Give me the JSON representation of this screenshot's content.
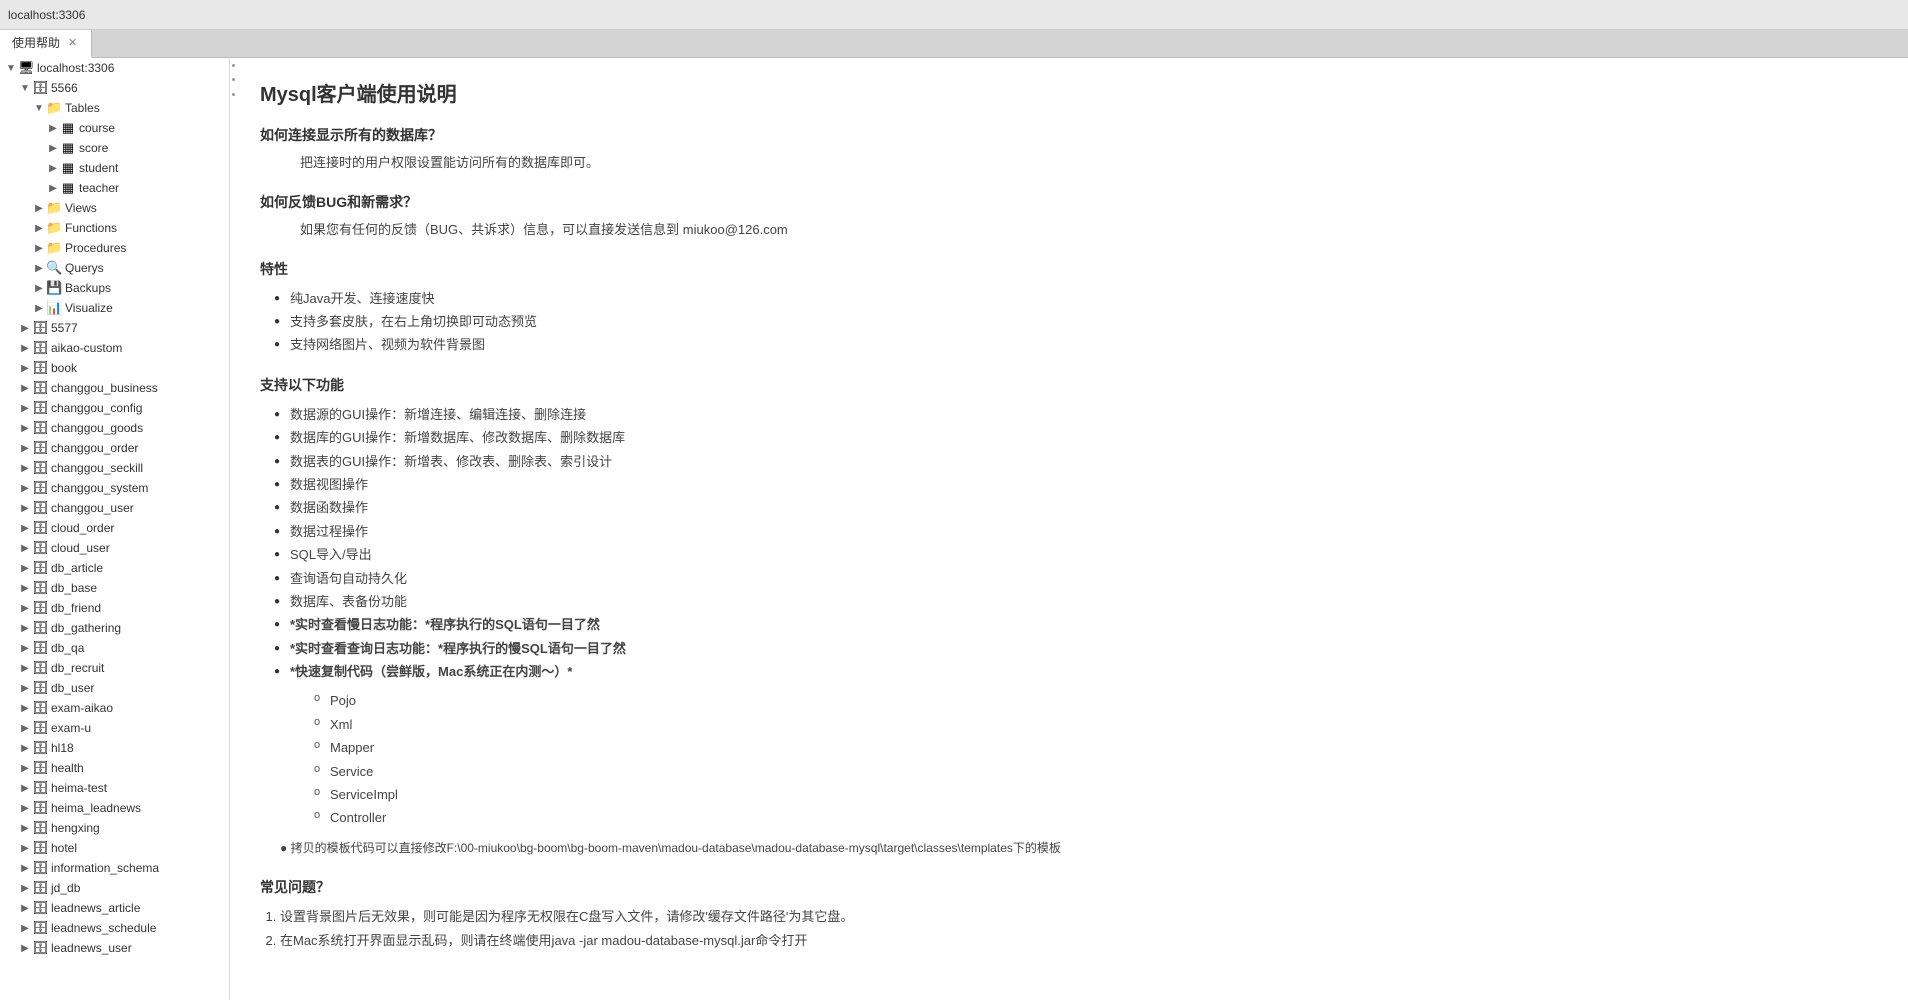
{
  "topbar": {
    "address": "localhost:3306"
  },
  "tabs": [
    {
      "label": "使用帮助",
      "active": true,
      "closable": true
    }
  ],
  "sidebar": {
    "databases": [
      {
        "name": "5566",
        "expanded": true,
        "children": [
          {
            "type": "folder",
            "name": "Tables",
            "expanded": true,
            "children": [
              {
                "name": "course"
              },
              {
                "name": "score"
              },
              {
                "name": "student"
              },
              {
                "name": "teacher"
              }
            ]
          },
          {
            "type": "folder",
            "name": "Views",
            "expanded": false
          },
          {
            "type": "folder",
            "name": "Functions",
            "expanded": false
          },
          {
            "type": "folder",
            "name": "Procedures",
            "expanded": false
          },
          {
            "type": "folder",
            "name": "Querys",
            "expanded": false
          },
          {
            "type": "folder",
            "name": "Backups",
            "expanded": false
          },
          {
            "type": "folder",
            "name": "Visualize",
            "expanded": false
          }
        ]
      },
      {
        "name": "5577",
        "expanded": false
      },
      {
        "name": "aikao-custom",
        "expanded": false
      },
      {
        "name": "book",
        "expanded": false
      },
      {
        "name": "changgou_business",
        "expanded": false
      },
      {
        "name": "changgou_config",
        "expanded": false
      },
      {
        "name": "changgou_goods",
        "expanded": false
      },
      {
        "name": "changgou_order",
        "expanded": false
      },
      {
        "name": "changgou_seckill",
        "expanded": false
      },
      {
        "name": "changgou_system",
        "expanded": false
      },
      {
        "name": "changgou_user",
        "expanded": false
      },
      {
        "name": "cloud_order",
        "expanded": false
      },
      {
        "name": "cloud_user",
        "expanded": false
      },
      {
        "name": "db_article",
        "expanded": false
      },
      {
        "name": "db_base",
        "expanded": false
      },
      {
        "name": "db_friend",
        "expanded": false
      },
      {
        "name": "db_gathering",
        "expanded": false
      },
      {
        "name": "db_qa",
        "expanded": false
      },
      {
        "name": "db_recruit",
        "expanded": false
      },
      {
        "name": "db_user",
        "expanded": false
      },
      {
        "name": "exam-aikao",
        "expanded": false
      },
      {
        "name": "exam-u",
        "expanded": false
      },
      {
        "name": "hl18",
        "expanded": false
      },
      {
        "name": "health",
        "expanded": false
      },
      {
        "name": "heima-test",
        "expanded": false
      },
      {
        "name": "heima_leadnews",
        "expanded": false
      },
      {
        "name": "hengxing",
        "expanded": false
      },
      {
        "name": "hotel",
        "expanded": false
      },
      {
        "name": "information_schema",
        "expanded": false
      },
      {
        "name": "jd_db",
        "expanded": false
      },
      {
        "name": "leadnews_article",
        "expanded": false
      },
      {
        "name": "leadnews_schedule",
        "expanded": false
      },
      {
        "name": "leadnews_user",
        "expanded": false
      }
    ]
  },
  "content": {
    "title": "Mysql客户端使用说明",
    "section1_title": "如何连接显示所有的数据库？",
    "section1_text": "把连接时的用户权限设置能访问所有的数据库即可。",
    "section2_title": "如何反馈BUG和新需求？",
    "section2_text": "如果您有任何的反馈（BUG、共诉求）信息，可以直接发送信息到 miukoo@126.com",
    "section3_title": "特性",
    "features": [
      "纯Java开发、连接速度快",
      "支持多套皮肤，在右上角切换即可动态预览",
      "支持网络图片、视频为软件背景图"
    ],
    "section4_title": "支持以下功能",
    "functions": [
      "数据源的GUI操作：新增连接、编辑连接、删除连接",
      "数据库的GUI操作：新增数据库、修改数据库、删除数据库",
      "数据表的GUI操作：新增表、修改表、删除表、索引设计",
      "数据视图操作",
      "数据函数操作",
      "数据过程操作",
      "SQL导入/导出",
      "查询语句自动持久化",
      "数据库、表备份功能",
      "*实时查看慢日志功能：*程序执行的SQL语句一目了然",
      "*实时查看查询日志功能：*程序执行的慢SQL语句一目了然",
      "*快速复制代码（尝鲜版，Mac系统正在内测～）*"
    ],
    "code_items": [
      "Pojo",
      "Xml",
      "Mapper",
      "Service",
      "ServiceImpl",
      "Controller"
    ],
    "template_text": "● 拷贝的模板代码可以直接修改F:\\00-miukoo\\bg-boom\\bg-boom-maven\\madou-database\\madou-database-mysql\\target\\classes\\templates下的模板",
    "section5_title": "常见问题？",
    "faq": [
      "设置背景图片后无效果，则可能是因为程序无权限在C盘写入文件，请修改'缓存文件路径'为其它盘。",
      "在Mac系统打开界面显示乱码，则请在终端使用java -jar madou-database-mysql.jar命令打开"
    ]
  }
}
